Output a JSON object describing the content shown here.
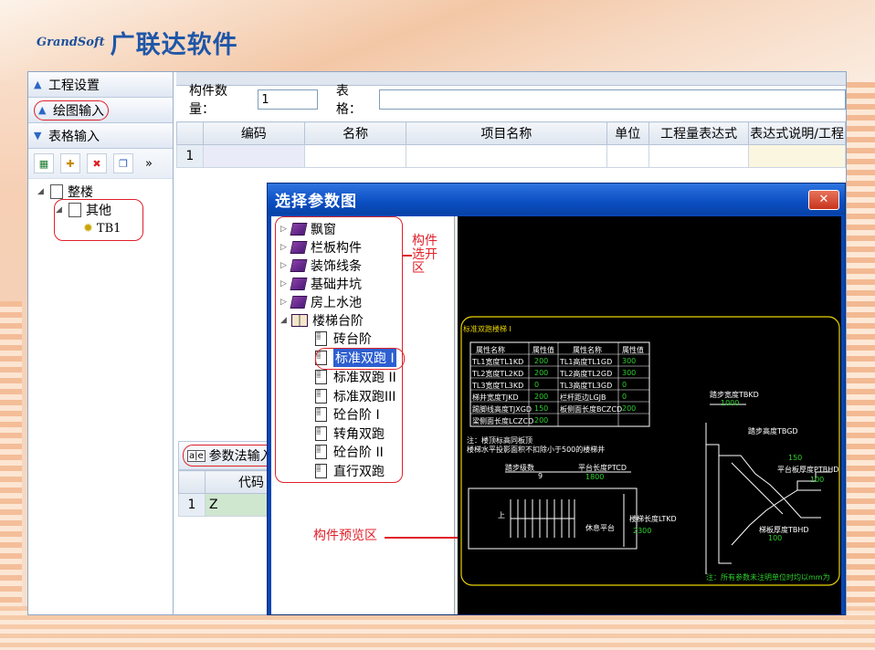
{
  "logo": {
    "mark": "GrandSoft",
    "text": "广联达软件"
  },
  "nav": {
    "project_settings": "工程设置",
    "drawing_input": "绘图输入",
    "table_input": "表格输入"
  },
  "toolbar": {
    "more": "»"
  },
  "tree": {
    "root": "整楼",
    "child": "其他",
    "leaf": "TB1"
  },
  "form": {
    "count_label": "构件数量：",
    "count_value": "1",
    "table_label": "表格："
  },
  "grid": {
    "headers": [
      "编码",
      "名称",
      "项目名称",
      "单位",
      "工程量表达式",
      "表达式说明/工程"
    ],
    "row_number": "1"
  },
  "param_tab": {
    "icon": "abe-icon",
    "label": "参数法输入"
  },
  "small_grid": {
    "header": "代码",
    "row_number": "1",
    "cell": "Z"
  },
  "dialog": {
    "title": "选择参数图",
    "close": "✕",
    "categories": [
      "飘窗",
      "栏板构件",
      "装饰线条",
      "基础井坑",
      "房上水池",
      "楼梯台阶"
    ],
    "stair_items": [
      "砖台阶",
      "标准双跑 I",
      "标准双跑 II",
      "标准双跑III",
      "砼台阶 I",
      "转角双跑",
      "砼台阶 II",
      "直行双跑"
    ],
    "selected": "标准双跑 I"
  },
  "annotations": {
    "component_select": "构件选开区",
    "component_preview": "构件预览区"
  },
  "preview": {
    "title": "标准双跑楼梯 I",
    "table_headers": [
      "属性名称",
      "属性值",
      "属性名称",
      "属性值"
    ],
    "table_rows": [
      [
        "TL1宽度TL1KD",
        "200",
        "TL1高度TL1GD",
        "300"
      ],
      [
        "TL2宽度TL2KD",
        "200",
        "TL2高度TL2GD",
        "300"
      ],
      [
        "TL3宽度TL3KD",
        "0",
        "TL3高度TL3GD",
        "0"
      ],
      [
        "梯井宽度TJKD",
        "200",
        "栏杆距边LGJB",
        "0"
      ],
      [
        "踢脚线高度TJXGD",
        "150",
        "板侧面长度BCZCD",
        "200"
      ],
      [
        "梁侧面长度LCZCD",
        "200",
        "",
        ""
      ]
    ],
    "note1": "注：楼顶标高同板顶",
    "note2": "楼梯水平投影面积不扣除小于500的楼梯井",
    "step_width_label": "踏步宽度TBKD",
    "step_width_value": "1000",
    "step_height_label": "踏步高度TBGD",
    "step_height_value": "150",
    "step_count_label": "踏步级数",
    "step_count_value": "9",
    "platform_len_label": "平台长度PTCD",
    "platform_len_value": "1800",
    "stair_len_label": "楼梯长度LTKD",
    "stair_len_value": "2300",
    "rest_platform": "休息平台",
    "up": "上",
    "slab_thick_label": "平台板厚度PTBHD",
    "slab_thick_value": "100",
    "step_slab_label": "梯板厚度TBHD",
    "step_slab_value": "100",
    "footer": "注：所有参数未注明单位时均以mm为"
  }
}
